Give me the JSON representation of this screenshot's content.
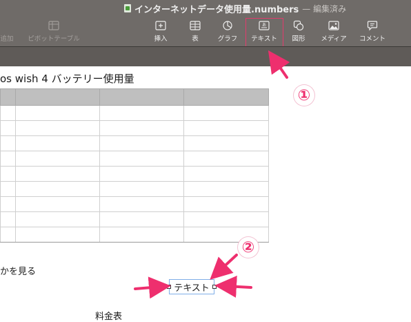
{
  "window": {
    "title": "インターネットデータ使用量.numbers",
    "status": "— 編集済み"
  },
  "toolbar": {
    "left_items": [
      {
        "label": "追加",
        "icon": "add-category-icon"
      },
      {
        "label": "ピボットテーブル",
        "icon": "pivot-table-icon"
      }
    ],
    "items": [
      {
        "label": "挿入",
        "icon": "insert-icon"
      },
      {
        "label": "表",
        "icon": "table-icon"
      },
      {
        "label": "グラフ",
        "icon": "chart-icon"
      },
      {
        "label": "テキスト",
        "icon": "text-box-icon"
      },
      {
        "label": "図形",
        "icon": "shape-icon"
      },
      {
        "label": "メディア",
        "icon": "media-icon"
      },
      {
        "label": "コメント",
        "icon": "comment-icon"
      }
    ],
    "highlighted_item": "テキスト"
  },
  "sheet": {
    "table_title": "os wish 4 バッテリー使用量",
    "note_text": "かを見る",
    "textbox_text": "テキスト",
    "footer_label": "料金表"
  },
  "annotations": {
    "marker1": "①",
    "marker2": "②",
    "color": "#ee2f6e"
  },
  "colors": {
    "toolbar_bg": "#6f6b68",
    "highlight": "#e33a6c",
    "textbox_border": "#7faee8"
  }
}
